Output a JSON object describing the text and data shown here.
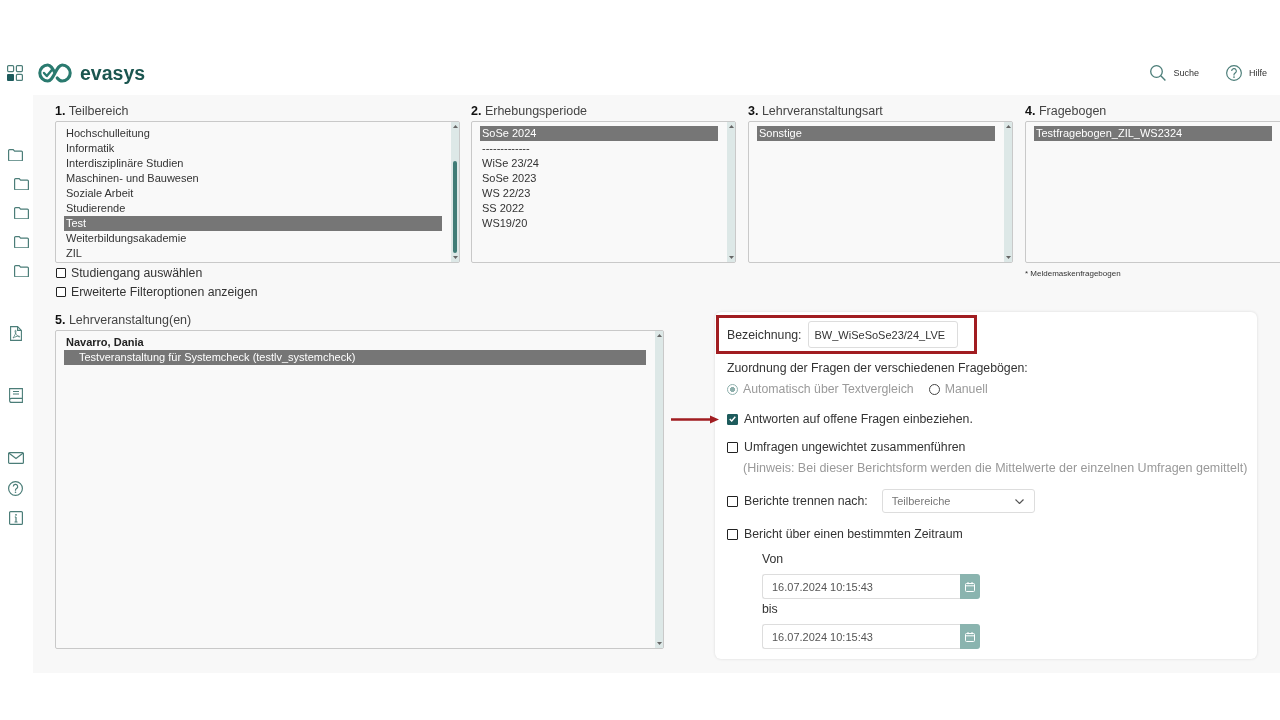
{
  "header": {
    "logo_text": "evasys",
    "actions": [
      {
        "kind": "search",
        "label": "Suche"
      },
      {
        "kind": "help",
        "label": "Hilfe"
      }
    ]
  },
  "filters": [
    {
      "title": "**1.** Teilbereich",
      "items": [
        {
          "label": "Hochschulleitung",
          "selected": false
        },
        {
          "label": "Informatik",
          "selected": false
        },
        {
          "label": "Interdisziplinäre Studien",
          "selected": false
        },
        {
          "label": "Maschinen- und Bauwesen",
          "selected": false
        },
        {
          "label": "Soziale Arbeit",
          "selected": false
        },
        {
          "label": "Studierende",
          "selected": false
        },
        {
          "label": "Test",
          "selected": true
        },
        {
          "label": "Weiterbildungsakademie",
          "selected": false
        },
        {
          "label": "ZIL",
          "selected": false
        }
      ],
      "options": [
        {
          "label": "Studiengang auswählen",
          "checked": false
        },
        {
          "label": "Erweiterte Filteroptionen anzeigen",
          "checked": false
        }
      ]
    },
    {
      "title": "**2.** Erhebungsperiode",
      "items": [
        {
          "label": "SoSe 2024",
          "selected": true
        },
        {
          "label": "-------------",
          "selected": false
        },
        {
          "label": "WiSe 23/24",
          "selected": false
        },
        {
          "label": "SoSe 2023",
          "selected": false
        },
        {
          "label": "WS 22/23",
          "selected": false
        },
        {
          "label": "SS 2022",
          "selected": false
        },
        {
          "label": "WS19/20",
          "selected": false
        }
      ]
    },
    {
      "title": "**3.** Lehrveranstaltungsart",
      "items": [
        {
          "label": "Sonstige",
          "selected": true
        }
      ]
    },
    {
      "title": "**4.** Fragebogen",
      "items": [
        {
          "label": "Testfragebogen_ZIL_WS2324",
          "selected": true
        }
      ],
      "note": "* Meldemaskenfragebogen"
    }
  ],
  "courses": {
    "title": "**5.** Lehrveranstaltung(en)",
    "items": [
      {
        "label": "Navarro, Dania",
        "children": [
          {
            "label": "Testveranstaltung für Systemcheck (testlv_systemcheck)",
            "selected": true
          }
        ]
      }
    ]
  },
  "report": {
    "name_field": {
      "label": "Bezeichnung:",
      "value": "BW_WiSeSoSe23/24_LVE",
      "highlighted": true
    },
    "mapping": {
      "label": "Zuordnung der Fragen der verschiedenen Fragebögen:",
      "disabled": true,
      "choices": [
        {
          "label": "Automatisch über Textvergleich",
          "selected": true
        },
        {
          "label": "Manuell",
          "selected": false
        }
      ]
    },
    "options": [
      {
        "kind": "checkbox",
        "label": "Antworten auf offene Fragen einbeziehen.",
        "checked": true,
        "pointed_at": true
      },
      {
        "kind": "checkbox",
        "label": "Umfragen ungewichtet zusammenführen",
        "checked": false,
        "hint": "(Hinweis: Bei dieser Berichtsform werden die Mittelwerte der einzelnen Umfragen gemittelt)"
      },
      {
        "kind": "dropdown",
        "label": "Berichte trennen nach:",
        "checked": false,
        "value": "Teilbereiche"
      },
      {
        "kind": "date_range",
        "label": "Bericht über einen bestimmten Zeitraum",
        "checked": false,
        "from_label": "Von",
        "from": "16.07.2024 10:15:43",
        "to_label": "bis",
        "to": "16.07.2024 10:15:43"
      }
    ]
  }
}
